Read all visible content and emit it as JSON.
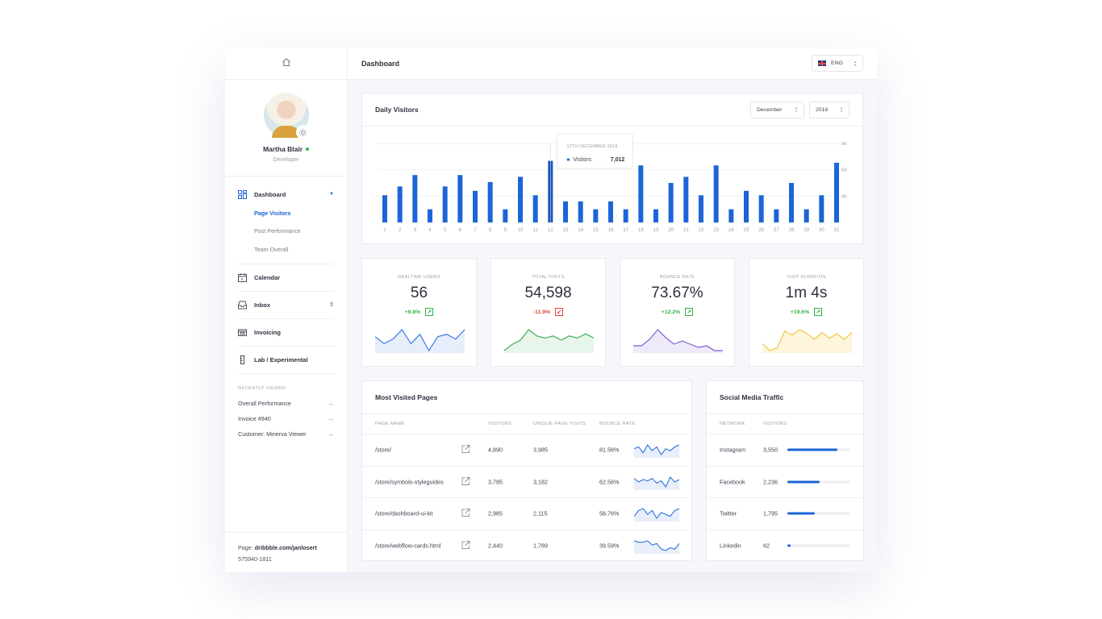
{
  "sidebar": {
    "user": {
      "name": "Martha Blair",
      "role": "Developer"
    },
    "nav": {
      "dashboard": "Dashboard",
      "sub": [
        "Page Visitors",
        "Post Performance",
        "Team Overall"
      ],
      "calendar": "Calendar",
      "inbox": "Inbox",
      "invoicing": "Invoicing",
      "lab": "Lab / Experimental"
    },
    "recent_title": "RECENTLY VIEWED",
    "recent": [
      "Overall Performance",
      "Invoice #940",
      "Customer: Minerva Viewer"
    ],
    "footer": {
      "prefix": "Page: ",
      "link": "dribbble.com/janlosert",
      "phone": "575940-1811"
    }
  },
  "topbar": {
    "title": "Dashboard",
    "language": "ENG"
  },
  "daily": {
    "title": "Daily Visitors",
    "month": "December",
    "year": "2018",
    "tooltip": {
      "date": "12TH DECEMBER 2018",
      "label": "Visitors",
      "value": "7,012"
    }
  },
  "chart_data": {
    "type": "bar",
    "title": "Daily Visitors",
    "categories": [
      "1",
      "2",
      "3",
      "4",
      "5",
      "6",
      "7",
      "8",
      "9",
      "10",
      "11",
      "12",
      "13",
      "14",
      "15",
      "16",
      "17",
      "18",
      "19",
      "20",
      "21",
      "22",
      "23",
      "24",
      "25",
      "26",
      "27",
      "28",
      "29",
      "30",
      "31"
    ],
    "values": [
      3100,
      4100,
      5400,
      1500,
      4100,
      5400,
      3600,
      4600,
      1500,
      5200,
      3100,
      7012,
      2400,
      2400,
      1500,
      2400,
      1500,
      6500,
      1500,
      4500,
      5200,
      3100,
      6500,
      1500,
      3600,
      3100,
      1500,
      4500,
      1500,
      3100,
      6800
    ],
    "y_ticks": [
      "3K",
      "6K",
      "9K"
    ],
    "ylim": [
      0,
      9000
    ],
    "highlight_index": 11
  },
  "stats": [
    {
      "label": "REALTIME USERS",
      "value": "56",
      "change": "+9.8%",
      "dir": "up",
      "color": "#3e7ce0",
      "fill": "#e6eefb",
      "spark": [
        18,
        15,
        17,
        21,
        15,
        19,
        12,
        18,
        19,
        17,
        21
      ]
    },
    {
      "label": "TOTAL VISITS",
      "value": "54,598",
      "change": "-11.9%",
      "dir": "down",
      "color": "#3fae58",
      "fill": "#e7f5ea",
      "spark": [
        2,
        5,
        7,
        12,
        9,
        8,
        9,
        7,
        9,
        8,
        10,
        8
      ]
    },
    {
      "label": "BOUNCE RATE",
      "value": "73.67%",
      "change": "+12.2%",
      "dir": "up",
      "color": "#7d5cd6",
      "fill": "#eeeaf9",
      "spark": [
        9,
        9,
        13,
        19,
        14,
        10,
        12,
        10,
        8,
        9,
        6,
        6
      ]
    },
    {
      "label": "VISIT DURATION",
      "value": "1m 4s",
      "change": "+19.6%",
      "dir": "up",
      "color": "#f4c542",
      "fill": "#fdf5dc",
      "spark": [
        8,
        3,
        5,
        17,
        14,
        18,
        15,
        11,
        16,
        12,
        15,
        11,
        16
      ]
    }
  ],
  "most_visited": {
    "title": "Most Visited Pages",
    "columns": [
      "PAGE NAME",
      "VISITORS",
      "UNIQUE PAGE VISITS",
      "BOUNCE RATE"
    ],
    "rows": [
      {
        "page": "/store/",
        "visitors": "4,890",
        "unique": "3,985",
        "bounce": "81.56%",
        "spark": [
          10,
          11,
          8,
          12,
          9,
          11,
          7,
          10,
          9,
          11,
          12
        ]
      },
      {
        "page": "/store/symbols-styleguides",
        "visitors": "3,785",
        "unique": "3,182",
        "bounce": "62.56%",
        "spark": [
          11,
          8,
          10,
          9,
          11,
          7,
          9,
          4,
          12,
          8,
          10
        ]
      },
      {
        "page": "/store/dashboard-ui-kit",
        "visitors": "2,985",
        "unique": "2,115",
        "bounce": "58.76%",
        "spark": [
          8,
          11,
          12,
          9,
          11,
          7,
          10,
          9,
          8,
          11,
          12
        ]
      },
      {
        "page": "/store/webflow-cards.html",
        "visitors": "2,440",
        "unique": "1,789",
        "bounce": "39.59%",
        "spark": [
          12,
          11,
          11,
          12,
          9,
          10,
          6,
          5,
          7,
          6,
          10
        ]
      }
    ]
  },
  "social": {
    "title": "Social Media Traffic",
    "columns": [
      "NETWORK",
      "VISITORS"
    ],
    "rows": [
      {
        "network": "Instagram",
        "visitors": "3,550",
        "fraction": 0.79
      },
      {
        "network": "Facebook",
        "visitors": "2,236",
        "fraction": 0.51
      },
      {
        "network": "Twitter",
        "visitors": "1,795",
        "fraction": 0.43
      },
      {
        "network": "Linkedin",
        "visitors": "62",
        "fraction": 0.05
      }
    ]
  },
  "colors": {
    "accent": "#1c64d8",
    "positive": "#2fb344",
    "negative": "#e0463a"
  },
  "icons": {
    "topbar_home": "home-icon",
    "dashboard": "grid-icon",
    "calendar": "calendar-icon",
    "inbox": "inbox-icon",
    "invoicing": "wallet-icon",
    "lab": "flask-icon",
    "external": "external-link-icon",
    "profile_settings": "gear-icon"
  }
}
